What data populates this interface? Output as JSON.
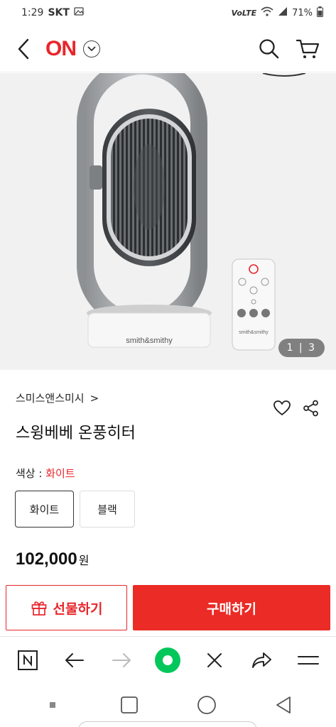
{
  "status_bar": {
    "time": "1:29",
    "carrier": "SKT",
    "network": "VoLTE",
    "battery": "71%"
  },
  "header": {
    "logo": "ON"
  },
  "product_image": {
    "counter": "1 | 3",
    "device_brand": "smith&smithy",
    "remote_brand": "smith&smithy"
  },
  "product": {
    "brand": "스미스앤스미시",
    "brand_arrow": ">",
    "title": "스윙베베 온풍히터",
    "color_label": "색상 : ",
    "color_selected": "화이트",
    "options": [
      "화이트",
      "블랙"
    ],
    "price": "102,000",
    "price_unit": "원"
  },
  "actions": {
    "gift_label": "선물하기",
    "buy_label": "구매하기"
  },
  "colors": {
    "accent": "#e8262b",
    "buy": "#eb2b25",
    "naver_green": "#03c75a"
  }
}
